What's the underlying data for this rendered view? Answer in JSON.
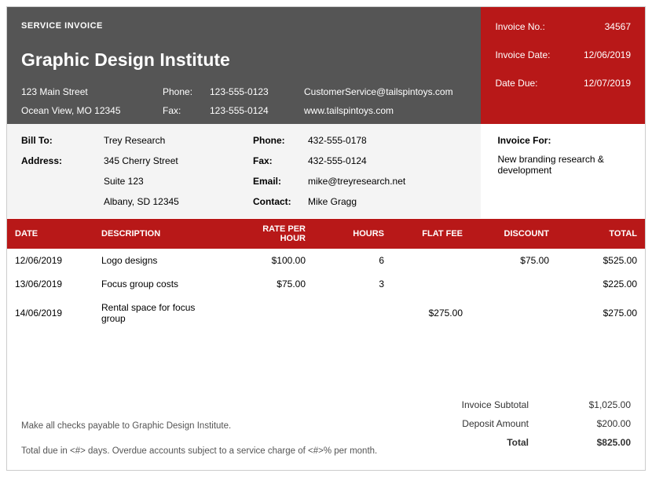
{
  "header": {
    "service_label": "SERVICE INVOICE",
    "company_name": "Graphic Design Institute",
    "addr_line1": "123 Main Street",
    "addr_line2": "Ocean View, MO 12345",
    "phone_label": "Phone:",
    "phone": "123-555-0123",
    "fax_label": "Fax:",
    "fax": "123-555-0124",
    "email": "CustomerService@tailspintoys.com",
    "website": "www.tailspintoys.com"
  },
  "invoice_meta": {
    "no_label": "Invoice No.:",
    "no": "34567",
    "date_label": "Invoice Date:",
    "date": "12/06/2019",
    "due_label": "Date Due:",
    "due": "12/07/2019"
  },
  "billto": {
    "billto_label": "Bill To:",
    "name": "Trey Research",
    "address_label": "Address:",
    "addr1": "345 Cherry Street",
    "addr2": "Suite 123",
    "addr3": "Albany, SD 12345",
    "phone_label": "Phone:",
    "phone": "432-555-0178",
    "fax_label": "Fax:",
    "fax": "432-555-0124",
    "email_label": "Email:",
    "email": "mike@treyresearch.net",
    "contact_label": "Contact:",
    "contact": "Mike Gragg"
  },
  "invoice_for": {
    "label": "Invoice For:",
    "text": "New branding research & development"
  },
  "columns": {
    "date": "DATE",
    "desc": "DESCRIPTION",
    "rate": "RATE PER HOUR",
    "hours": "HOURS",
    "flat": "FLAT FEE",
    "discount": "DISCOUNT",
    "total": "TOTAL"
  },
  "rows": [
    {
      "date": "12/06/2019",
      "desc": "Logo designs",
      "rate": "$100.00",
      "hours": "6",
      "flat": "",
      "discount": "$75.00",
      "total": "$525.00"
    },
    {
      "date": "13/06/2019",
      "desc": "Focus group costs",
      "rate": "$75.00",
      "hours": "3",
      "flat": "",
      "discount": "",
      "total": "$225.00"
    },
    {
      "date": "14/06/2019",
      "desc": "Rental space for focus group",
      "rate": "",
      "hours": "",
      "flat": "$275.00",
      "discount": "",
      "total": "$275.00"
    }
  ],
  "footer": {
    "paynote": "Make all checks payable to Graphic Design Institute.",
    "terms": "Total due in <#> days. Overdue accounts subject to a service charge of <#>% per month.",
    "subtotal_label": "Invoice Subtotal",
    "subtotal": "$1,025.00",
    "deposit_label": "Deposit Amount",
    "deposit": "$200.00",
    "total_label": "Total",
    "total": "$825.00"
  }
}
